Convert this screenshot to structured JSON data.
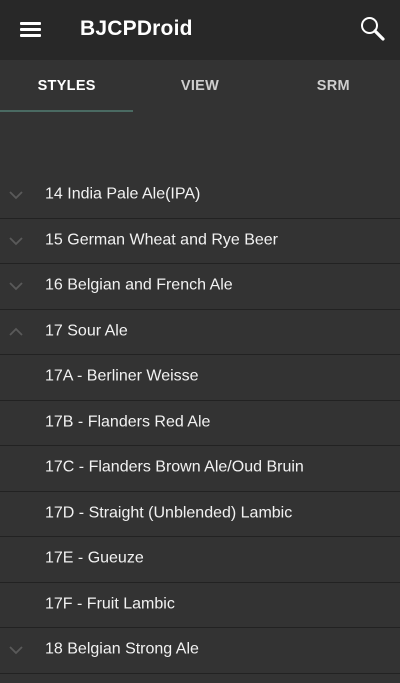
{
  "toolbar": {
    "title": "BJCPDroid",
    "menu_icon": "hamburger-menu-icon",
    "search_icon": "search-icon"
  },
  "tabs": [
    {
      "label": "STYLES",
      "active": true
    },
    {
      "label": "VIEW",
      "active": false
    },
    {
      "label": "SRM",
      "active": false
    }
  ],
  "colors": {
    "toolbar_bg": "#282828",
    "background": "#333333",
    "tab_indicator": "#4a6a62",
    "chevron": "#5a5a5a"
  },
  "list": {
    "items": [
      {
        "label": "14 India Pale Ale(IPA)",
        "type": "category",
        "expanded": false
      },
      {
        "label": "15 German Wheat and Rye Beer",
        "type": "category",
        "expanded": false
      },
      {
        "label": "16 Belgian and French Ale",
        "type": "category",
        "expanded": false
      },
      {
        "label": "17 Sour Ale",
        "type": "category",
        "expanded": true
      },
      {
        "label": "17A - Berliner Weisse",
        "type": "style"
      },
      {
        "label": "17B - Flanders Red Ale",
        "type": "style"
      },
      {
        "label": "17C - Flanders Brown Ale/Oud Bruin",
        "type": "style"
      },
      {
        "label": "17D - Straight (Unblended) Lambic",
        "type": "style"
      },
      {
        "label": "17E - Gueuze",
        "type": "style"
      },
      {
        "label": "17F - Fruit Lambic",
        "type": "style"
      },
      {
        "label": "18 Belgian Strong Ale",
        "type": "category",
        "expanded": false
      }
    ]
  }
}
